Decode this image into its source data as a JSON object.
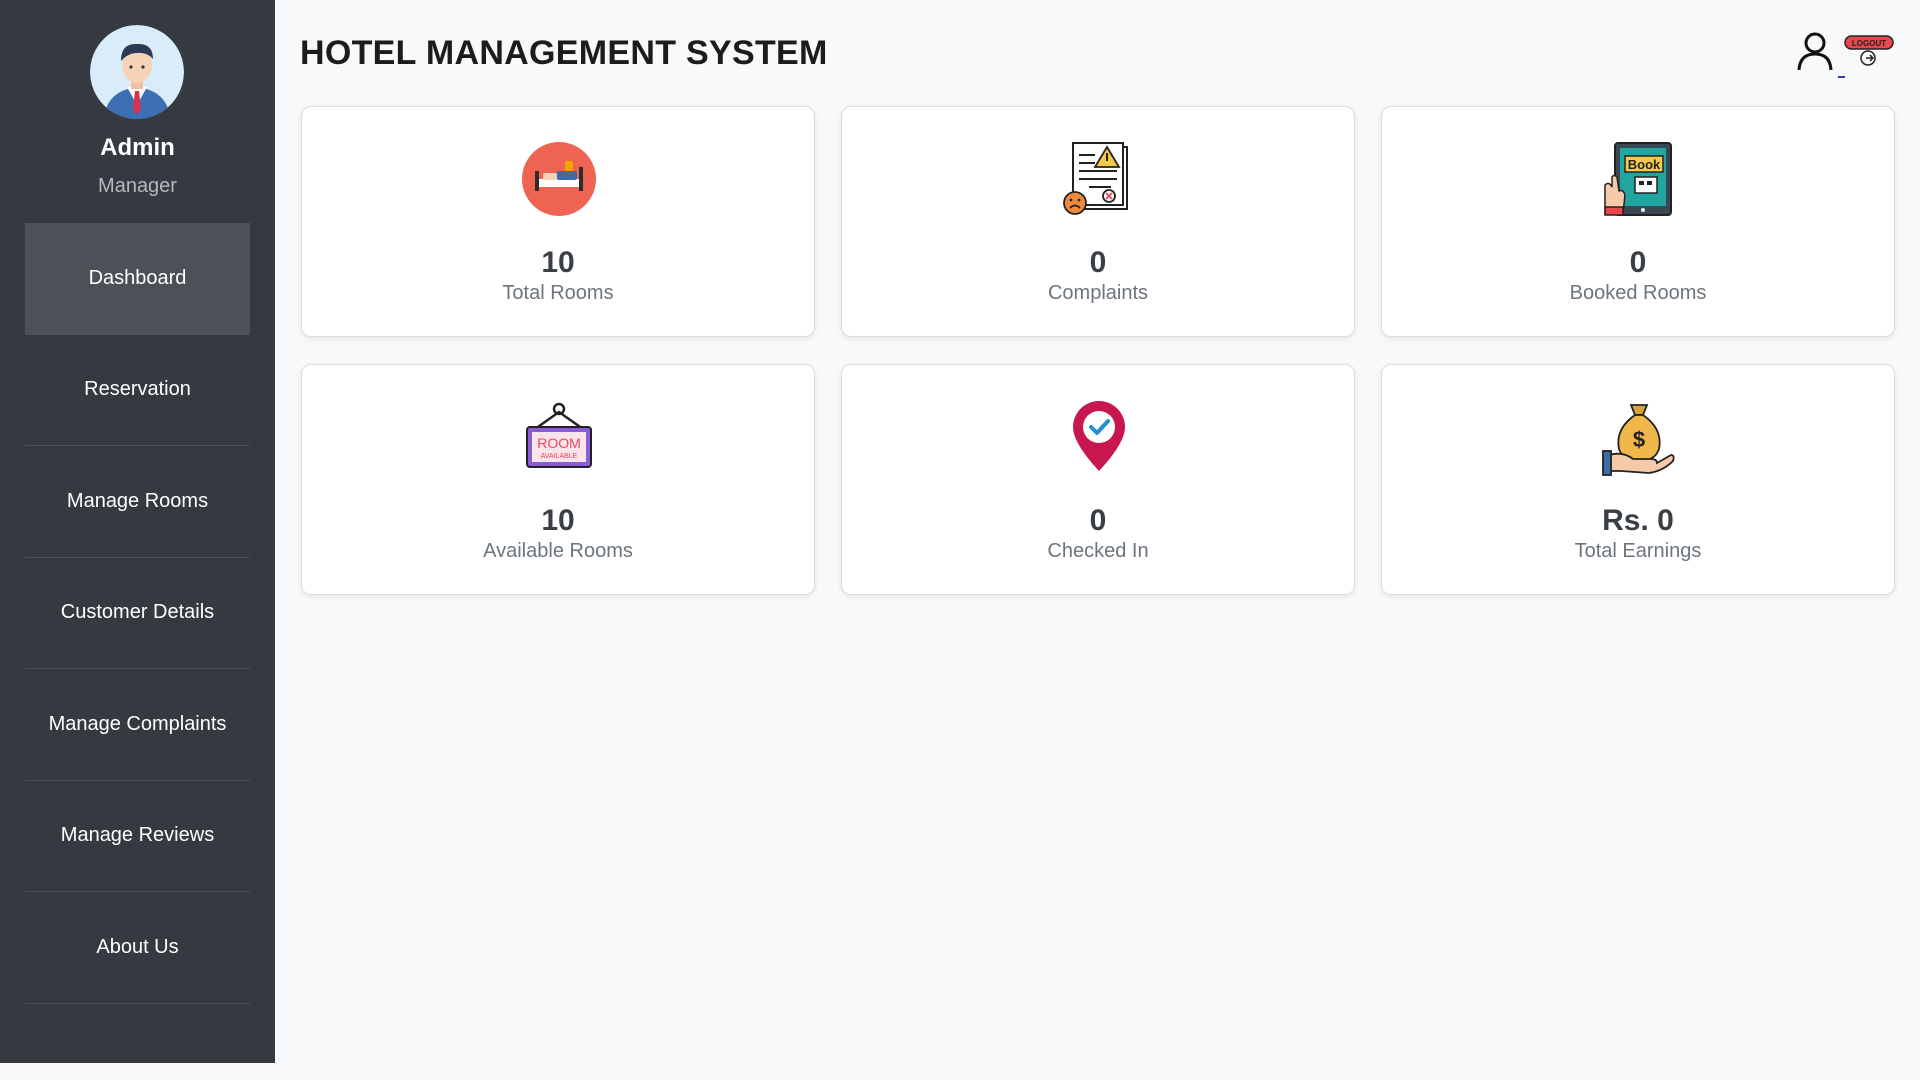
{
  "header": {
    "title": "HOTEL MANAGEMENT SYSTEM"
  },
  "topbar": {
    "user_icon": "user-icon",
    "logout_badge": "LOGOUT"
  },
  "profile": {
    "name": "Admin",
    "role": "Manager"
  },
  "sidebar": {
    "items": [
      {
        "label": "Dashboard",
        "active": true
      },
      {
        "label": "Reservation"
      },
      {
        "label": "Manage Rooms"
      },
      {
        "label": "Customer Details"
      },
      {
        "label": "Manage Complaints"
      },
      {
        "label": "Manage Reviews"
      },
      {
        "label": "About Us"
      }
    ]
  },
  "cards": [
    {
      "value": "10",
      "label": "Total Rooms",
      "icon": "bed-icon"
    },
    {
      "value": "0",
      "label": "Complaints",
      "icon": "complaint-document-icon"
    },
    {
      "value": "0",
      "label": "Booked Rooms",
      "icon": "booking-tablet-icon"
    },
    {
      "value": "10",
      "label": "Available Rooms",
      "icon": "room-available-sign-icon"
    },
    {
      "value": "0",
      "label": "Checked In",
      "icon": "location-check-icon"
    },
    {
      "value": "Rs. 0",
      "label": "Total Earnings",
      "icon": "money-bag-hand-icon"
    }
  ],
  "colors": {
    "sidebar": "#343a40",
    "sidebar_active": "#4b5157",
    "background": "#f8f9fa",
    "bed_circle": "#ee6352",
    "pin": "#c8174f"
  }
}
